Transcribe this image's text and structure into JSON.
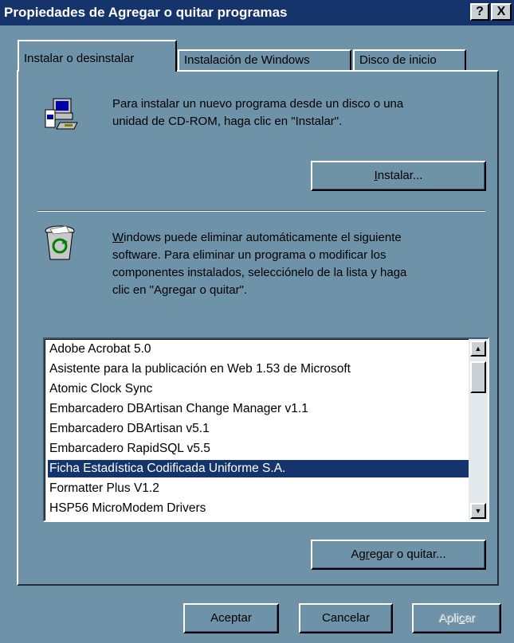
{
  "window": {
    "title": "Propiedades de Agregar o quitar programas",
    "help_label": "?",
    "close_label": "X"
  },
  "tabs": [
    {
      "label": "Instalar o desinstalar",
      "active": true
    },
    {
      "label": "Instalación de Windows",
      "active": false
    },
    {
      "label": "Disco de inicio",
      "active": false
    }
  ],
  "install": {
    "icon": "computer-install-icon",
    "description_line1": "Para instalar un nuevo programa desde un disco o una",
    "description_line2": "unidad de CD-ROM, haga clic en \"Instalar\".",
    "button_label": "Instalar..."
  },
  "uninstall": {
    "icon": "recycle-bin-icon",
    "line1_rest": "indows puede eliminar automáticamente el siguiente",
    "line1_accel": "W",
    "line2": "software. Para eliminar un programa o modificar los",
    "line3": "componentes instalados, selecciónelo de la lista y haga",
    "line4": "clic en \"Agregar o quitar\"."
  },
  "programs": [
    "Adobe Acrobat 5.0",
    "Asistente para la publicación en Web 1.53 de Microsoft",
    "Atomic Clock Sync",
    "Embarcadero DBArtisan Change Manager v1.1",
    "Embarcadero DBArtisan v5.1",
    "Embarcadero RapidSQL v5.5",
    "Ficha Estadística Codificada Uniforme S.A.",
    "Formatter Plus V1.2",
    "HSP56 MicroModem Drivers"
  ],
  "selected_program": "Ficha Estadística Codificada Uniforme S.A.",
  "add_remove": {
    "pre": "Ag",
    "accel": "r",
    "post": "egar o quitar..."
  },
  "footer": {
    "ok_label": "Aceptar",
    "cancel_label": "Cancelar",
    "apply_pre": "Apli",
    "apply_accel": "c",
    "apply_post": "ar"
  },
  "colors": {
    "dialog_face": "#6e92a8",
    "titlebar": "#15346b",
    "selection": "#15346b"
  }
}
